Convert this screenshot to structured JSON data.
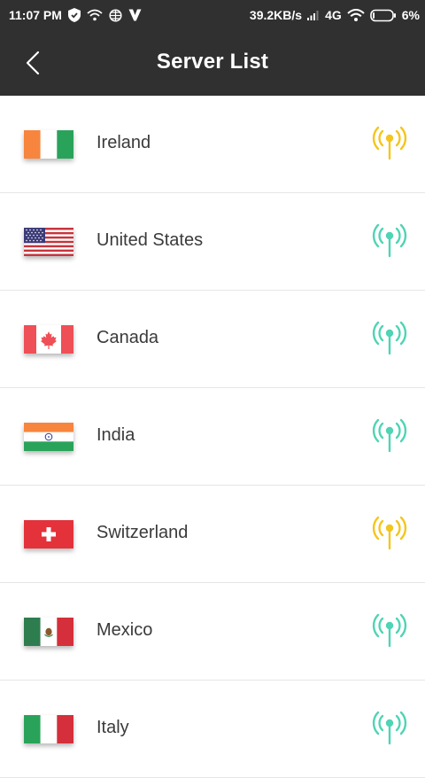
{
  "status_bar": {
    "time": "11:07 PM",
    "speed": "39.2KB/s",
    "network": "4G",
    "battery": "6%"
  },
  "header": {
    "title": "Server List"
  },
  "servers": [
    {
      "name": "Ireland",
      "flag": "ireland-flag",
      "signal": "medium",
      "signal_color": "#f4c51d"
    },
    {
      "name": "United States",
      "flag": "us-flag",
      "signal": "strong",
      "signal_color": "#4fd4b5"
    },
    {
      "name": "Canada",
      "flag": "canada-flag",
      "signal": "strong",
      "signal_color": "#4fd4b5"
    },
    {
      "name": "India",
      "flag": "india-flag",
      "signal": "strong",
      "signal_color": "#4fd4b5"
    },
    {
      "name": "Switzerland",
      "flag": "switzerland-flag",
      "signal": "medium",
      "signal_color": "#f4c51d"
    },
    {
      "name": "Mexico",
      "flag": "mexico-flag",
      "signal": "strong",
      "signal_color": "#4fd4b5"
    },
    {
      "name": "Italy",
      "flag": "italy-flag",
      "signal": "strong",
      "signal_color": "#4fd4b5"
    }
  ],
  "colors": {
    "header_bg": "#2f302f",
    "signal_good": "#4fd4b5",
    "signal_medium": "#f4c51d"
  }
}
